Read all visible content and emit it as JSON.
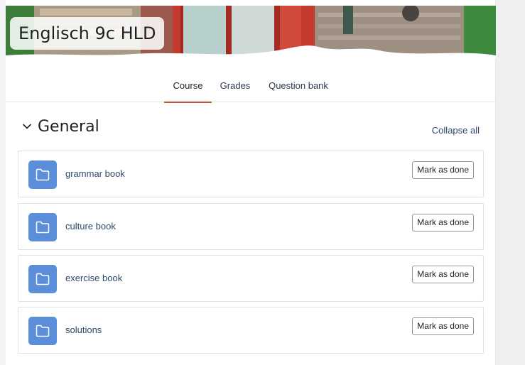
{
  "course": {
    "title": "Englisch 9c HLD"
  },
  "tabs": [
    {
      "label": "Course",
      "active": true
    },
    {
      "label": "Grades",
      "active": false
    },
    {
      "label": "Question bank",
      "active": false
    }
  ],
  "section": {
    "title": "General",
    "collapse_label": "Collapse all",
    "toggle_icon": "chevron-down-icon"
  },
  "activities": [
    {
      "name": "grammar book",
      "icon": "folder-icon",
      "button": "Mark as done"
    },
    {
      "name": "culture book",
      "icon": "folder-icon",
      "button": "Mark as done"
    },
    {
      "name": "exercise book",
      "icon": "folder-icon",
      "button": "Mark as done"
    },
    {
      "name": "solutions",
      "icon": "folder-icon",
      "button": "Mark as done"
    }
  ],
  "colors": {
    "active_tab_underline": "#c65a38",
    "folder_icon_bg": "#5b8ed8",
    "link_text": "#2c4a6b"
  }
}
